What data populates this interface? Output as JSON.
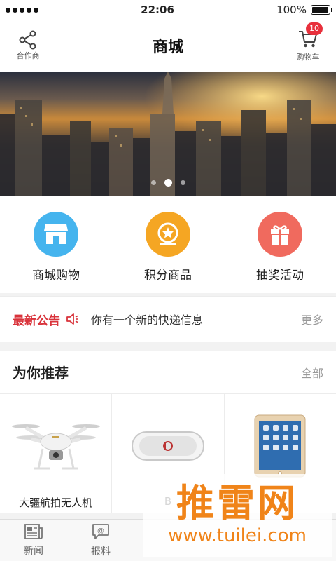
{
  "status": {
    "time": "22:06",
    "battery": "100%"
  },
  "nav": {
    "title": "商城",
    "left_label": "合作商",
    "right_label": "购物车",
    "cart_count": "10"
  },
  "banner": {
    "slide_count": 3,
    "active_index": 1
  },
  "quick_menu": [
    {
      "label": "商城购物",
      "color": "#45b4ee"
    },
    {
      "label": "积分商品",
      "color": "#f5a623"
    },
    {
      "label": "抽奖活动",
      "color": "#f06a5e"
    }
  ],
  "notice": {
    "title": "最新公告",
    "text": "你有一个新的快递信息",
    "more": "更多"
  },
  "recommend": {
    "title": "为你推荐",
    "all": "全部",
    "products": [
      {
        "name": "大疆航拍无人机"
      },
      {
        "name": "B"
      },
      {
        "name": ""
      }
    ]
  },
  "tabs": [
    {
      "label": "新闻"
    },
    {
      "label": "报料"
    }
  ],
  "watermark": {
    "main": "推雷网",
    "sub": "www.tuilei.com"
  }
}
